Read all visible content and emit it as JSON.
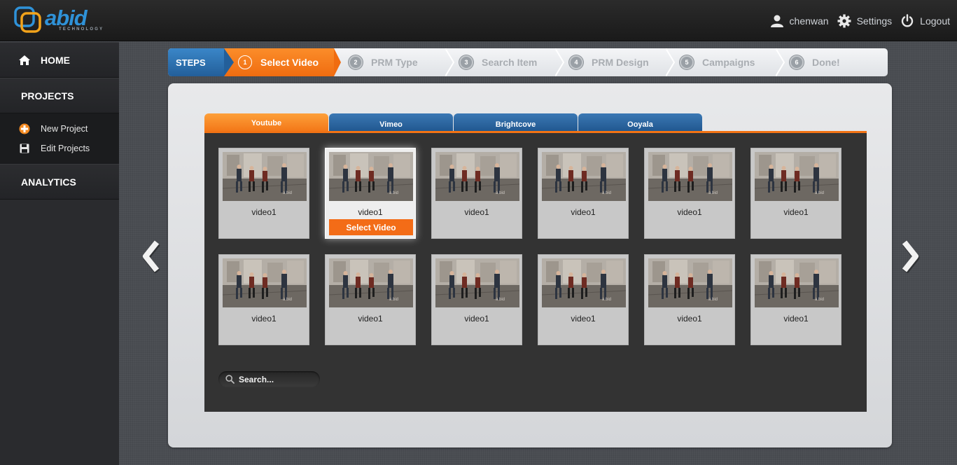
{
  "brand": {
    "name": "abid",
    "tagline": "TECHNOLOGY",
    "accent": "#2f92d8"
  },
  "topbar": {
    "username": "chenwan",
    "settings_label": "Settings",
    "logout_label": "Logout"
  },
  "sidebar": {
    "home_label": "HOME",
    "projects_label": "PROJECTS",
    "new_project_label": "New Project",
    "edit_projects_label": "Edit Projects",
    "analytics_label": "ANALYTICS"
  },
  "steps": {
    "label": "STEPS",
    "items": [
      {
        "num": "1",
        "label": "Select Video",
        "active": true
      },
      {
        "num": "2",
        "label": "PRM Type",
        "active": false
      },
      {
        "num": "3",
        "label": "Search Item",
        "active": false
      },
      {
        "num": "4",
        "label": "PRM Design",
        "active": false
      },
      {
        "num": "5",
        "label": "Campaigns",
        "active": false
      },
      {
        "num": "6",
        "label": "Done!",
        "active": false
      }
    ]
  },
  "tabs": [
    {
      "label": "Youtube",
      "active": true
    },
    {
      "label": "Vimeo",
      "active": false
    },
    {
      "label": "Brightcove",
      "active": false
    },
    {
      "label": "Ooyala",
      "active": false
    }
  ],
  "videos": {
    "row1": [
      "video1",
      "video1",
      "video1",
      "video1",
      "video1",
      "video1"
    ],
    "row2": [
      "video1",
      "video1",
      "video1",
      "video1",
      "video1",
      "video1"
    ],
    "selected_index": 1,
    "select_button_label": "Select Video"
  },
  "search": {
    "placeholder": "Search..."
  },
  "colors": {
    "orange": "#f36c17",
    "blue": "#235f9a",
    "dark": "#333333"
  }
}
